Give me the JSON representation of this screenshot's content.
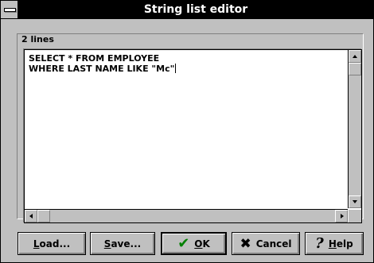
{
  "window": {
    "title": "String list editor"
  },
  "editor": {
    "line_count_label": "2 lines",
    "lines": [
      "SELECT * FROM EMPLOYEE",
      "WHERE LAST NAME LIKE \"Mc\""
    ]
  },
  "buttons": {
    "load": {
      "pre": "",
      "ul": "L",
      "post": "oad..."
    },
    "save": {
      "pre": "",
      "ul": "S",
      "post": "ave..."
    },
    "ok": {
      "pre": "",
      "ul": "O",
      "post": "K"
    },
    "cancel": {
      "pre": "Cancel",
      "ul": "",
      "post": ""
    },
    "help": {
      "pre": "",
      "ul": "H",
      "post": "elp"
    }
  },
  "icons": {
    "ok": "check-icon",
    "cancel": "cross-icon",
    "help": "question-mark-icon"
  },
  "colors": {
    "title_bar": "#000000",
    "face": "#c0c0c0",
    "check": "#008000"
  }
}
